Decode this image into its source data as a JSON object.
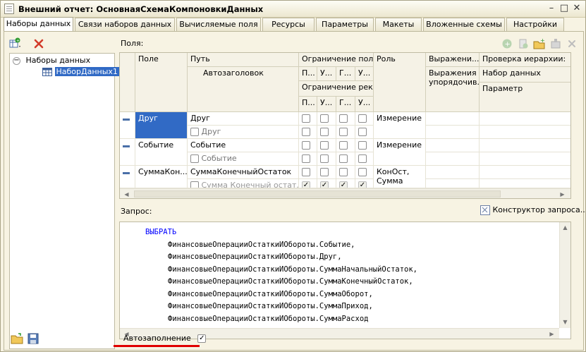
{
  "window": {
    "title": "Внешний отчет: ОсновнаяСхемаКомпоновкиДанных"
  },
  "tabs": [
    "Наборы данных",
    "Связи наборов данных",
    "Вычисляемые поля",
    "Ресурсы",
    "Параметры",
    "Макеты",
    "Вложенные схемы",
    "Настройки"
  ],
  "tree": {
    "root": "Наборы данных",
    "child": "НаборДанных1"
  },
  "fields": {
    "label": "Поля:",
    "headers": {
      "pole": "Поле",
      "put": "Путь",
      "avtozagolovok": "Автозаголовок",
      "ogr_polya": "Ограничение поля",
      "ogr_sub": [
        "П...",
        "У...",
        "Г...",
        "У..."
      ],
      "ogr_rek": "Ограничение рек...",
      "rol": "Роль",
      "vyrazh": "Выражени...",
      "vyrazh_uporyad": "Выражения упорядочив...",
      "proverka": "Проверка иерархии:",
      "nabor": "Набор данных",
      "parametr": "Параметр"
    },
    "rows": [
      {
        "pole": "Друг",
        "put": "Друг",
        "zag": "Друг",
        "rol": "Измерение"
      },
      {
        "pole": "Событие",
        "put": "Событие",
        "zag": "Событие",
        "rol": "Измерение"
      },
      {
        "pole": "СуммаКон...",
        "put": "СуммаКонечныйОстаток",
        "zag": "Сумма Конечный остат...",
        "rol": "КонОст, Сумма"
      }
    ]
  },
  "query": {
    "label": "Запрос:",
    "constructor": "Конструктор запроса...",
    "keyword": "ВЫБРАТЬ",
    "lines": [
      "ФинансовыеОперацииОстаткиИОбороты.Событие,",
      "ФинансовыеОперацииОстаткиИОбороты.Друг,",
      "ФинансовыеОперацииОстаткиИОбороты.СуммаНачальныйОстаток,",
      "ФинансовыеОперацииОстаткиИОбороты.СуммаКонечныйОстаток,",
      "ФинансовыеОперацииОстаткиИОбороты.СуммаОборот,",
      "ФинансовыеОперацииОстаткиИОбороты.СуммаПриход,",
      "ФинансовыеОперацииОстаткиИОбороты.СуммаРасход"
    ]
  },
  "autofill": {
    "label": "Автозаполнение",
    "checked": true
  },
  "colors": {
    "accent": "#316ac5",
    "keyword": "#0000ff",
    "underline": "#e00000"
  }
}
